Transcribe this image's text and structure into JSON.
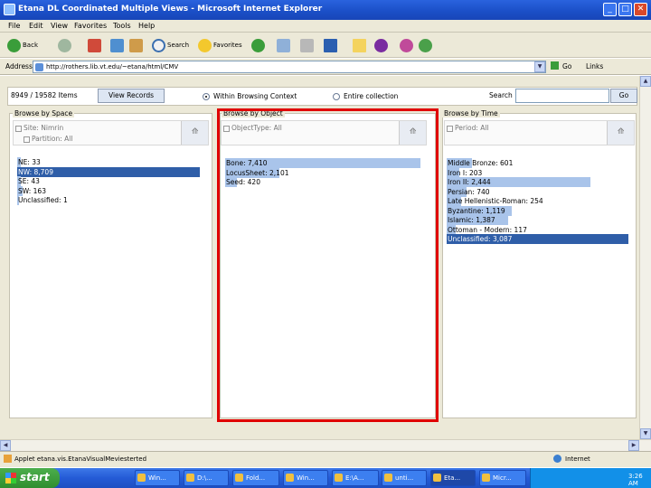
{
  "window": {
    "title": "Etana DL Coordinated Multiple Views - Microsoft Internet Explorer",
    "min": "_",
    "max": "□",
    "close": "✕"
  },
  "menu": [
    "File",
    "Edit",
    "View",
    "Favorites",
    "Tools",
    "Help"
  ],
  "toolbar": {
    "back": "Back",
    "search": "Search",
    "favorites": "Favorites"
  },
  "address": {
    "label": "Address",
    "url": "http://rothers.lib.vt.edu/~etana/html/CMV",
    "go": "Go",
    "links": "Links"
  },
  "app": {
    "count": "8949 / 19582 Items",
    "view_records": "View Records",
    "radio_within": "Within Browsing Context",
    "radio_entire": "Entire collection",
    "search_label": "Search",
    "search_go": "Go",
    "panels": [
      {
        "title": "Browse by Space",
        "filters": [
          "Site: Nimrin",
          "Partition: All"
        ],
        "button": "⟰",
        "items": [
          {
            "label": "NE: 33",
            "frac": 0.02
          },
          {
            "label": "NW: 8,709",
            "frac": 1.0,
            "selected": true
          },
          {
            "label": "SE: 43",
            "frac": 0.02
          },
          {
            "label": "SW: 163",
            "frac": 0.03
          },
          {
            "label": "Unclassified: 1",
            "frac": 0.01
          }
        ]
      },
      {
        "title": "Browse by Object",
        "filters": [
          "ObjectType: All"
        ],
        "button": "⟰",
        "items": [
          {
            "label": "Bone: 7,410",
            "frac": 1.0
          },
          {
            "label": "LocusSheet: 2,101",
            "frac": 0.28
          },
          {
            "label": "Seed: 420",
            "frac": 0.06
          }
        ]
      },
      {
        "title": "Browse by Time",
        "filters": [
          "Period: All"
        ],
        "button": "⟰",
        "items": [
          {
            "label": "Middle Bronze: 601",
            "frac": 0.14
          },
          {
            "label": "Iron I: 203",
            "frac": 0.07
          },
          {
            "label": "Iron II: 2,444",
            "frac": 0.79
          },
          {
            "label": "Persian: 740",
            "frac": 0.11
          },
          {
            "label": "Late Hellenistic-Roman: 254",
            "frac": 0.08
          },
          {
            "label": "Byzantine: 1,119",
            "frac": 0.36
          },
          {
            "label": "Islamic: 1,387",
            "frac": 0.34
          },
          {
            "label": "Ottoman - Modern: 117",
            "frac": 0.05
          },
          {
            "label": "Unclassified: 3,087",
            "frac": 1.0,
            "selected": true
          }
        ]
      }
    ]
  },
  "status": {
    "left": "Applet etana.vis.EtanaVisualMeviesterted",
    "zone": "Internet"
  },
  "taskbar": {
    "start": "start",
    "buttons": [
      "Win...",
      "D:\\...",
      "Fold...",
      "Win...",
      "E:\\A...",
      "unti...",
      "Eta...",
      "Micr..."
    ],
    "clock": "3:26 AM"
  },
  "colors": {
    "bar_light": "#a9c4ea",
    "bar_selected": "#2f5ea8",
    "frame": "#e00000"
  }
}
